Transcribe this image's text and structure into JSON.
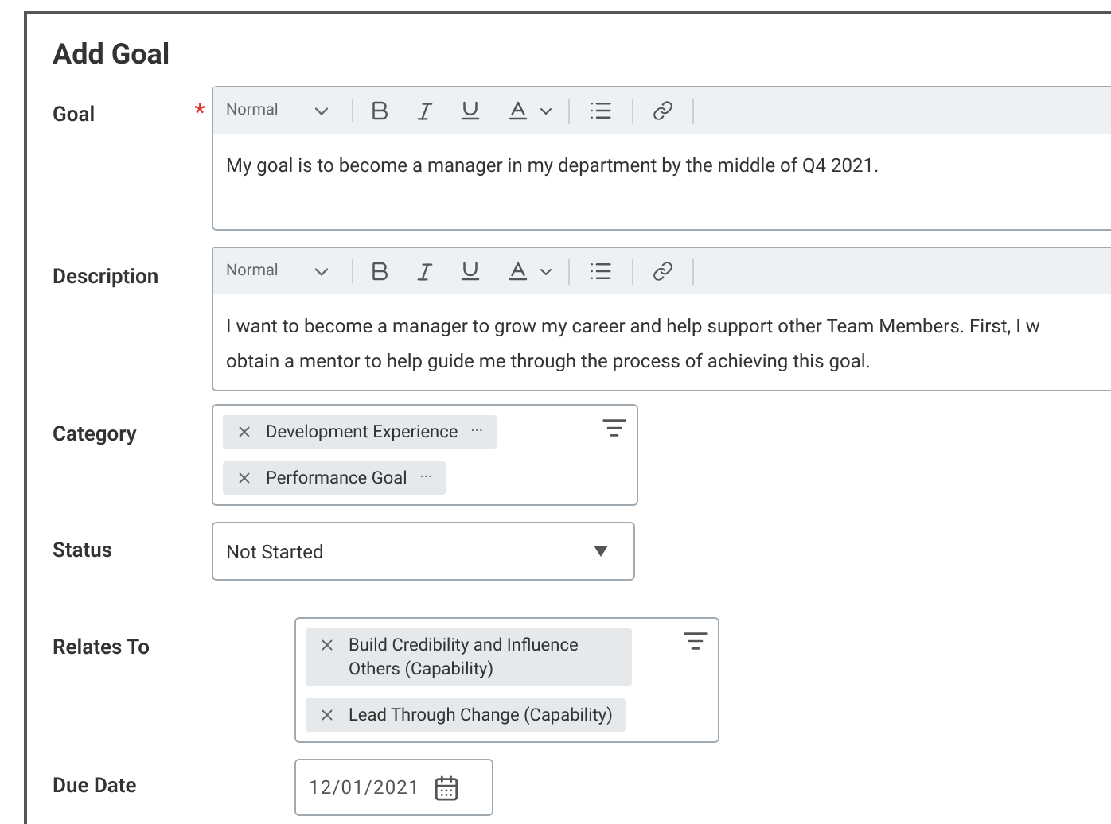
{
  "title": "Add Goal",
  "fields": [
    {
      "kind": "editor",
      "label": "Goal",
      "required_mark": "*",
      "style": "Normal",
      "lines": [
        "My goal is to become a manager in my department by the middle of Q4 2021."
      ]
    },
    {
      "kind": "editor",
      "label": "Description",
      "style": "Normal",
      "lines": [
        "I want to become a manager to grow my career and help support other Team Members. First, I w",
        "obtain a mentor to help guide me through the process of achieving this goal."
      ]
    },
    {
      "kind": "tags",
      "label": "Category",
      "tags": [
        {
          "text": "Development Experience",
          "more": "···"
        },
        {
          "text": "Performance Goal",
          "more": "···"
        }
      ]
    },
    {
      "kind": "select",
      "label": "Status",
      "value": "Not Started"
    },
    {
      "kind": "tags",
      "label": "Relates To",
      "tags": [
        {
          "text": "Build Credibility and Influence Others (Capability)"
        },
        {
          "text": "Lead Through Change (Capability)"
        }
      ]
    },
    {
      "kind": "date",
      "label": "Due Date",
      "value": "12/01/2021"
    }
  ]
}
